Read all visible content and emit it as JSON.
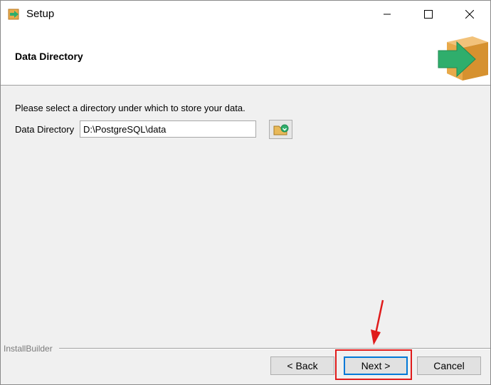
{
  "window": {
    "title": "Setup",
    "controls": {
      "minimize": "minimize",
      "maximize": "maximize",
      "close": "close"
    }
  },
  "header": {
    "title": "Data Directory",
    "logo_icon": "installer-box-arrow-icon"
  },
  "content": {
    "prompt": "Please select a directory under which to store your data.",
    "field_label": "Data Directory",
    "field_value": "D:\\PostgreSQL\\data",
    "browse_icon": "folder-browse-icon"
  },
  "footer": {
    "brand": "InstallBuilder",
    "back_label": "< Back",
    "next_label": "Next >",
    "cancel_label": "Cancel"
  },
  "colors": {
    "accent": "#0078d7",
    "annotation": "#e01b1b",
    "logo_green": "#2fae6c",
    "logo_box": "#e8a94a"
  }
}
